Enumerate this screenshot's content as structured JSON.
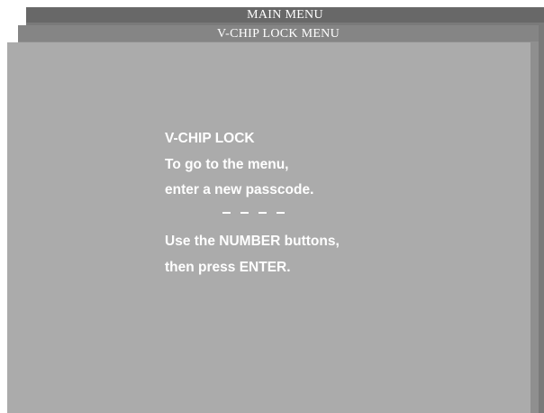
{
  "main_menu": {
    "title": "MAIN MENU"
  },
  "vchip_menu": {
    "title": "V-CHIP LOCK MENU"
  },
  "content": {
    "heading": "V-CHIP LOCK",
    "line1": "To go to the menu,",
    "line2": "enter a new passcode.",
    "passcode_digits": 4,
    "passcode_entered": "",
    "line3": "Use the NUMBER buttons,",
    "line4": "then press ENTER."
  },
  "colors": {
    "main_window": "#7a7a7a",
    "vchip_window": "#8f8f8f",
    "content_panel": "#ababab",
    "text": "#ffffff"
  }
}
